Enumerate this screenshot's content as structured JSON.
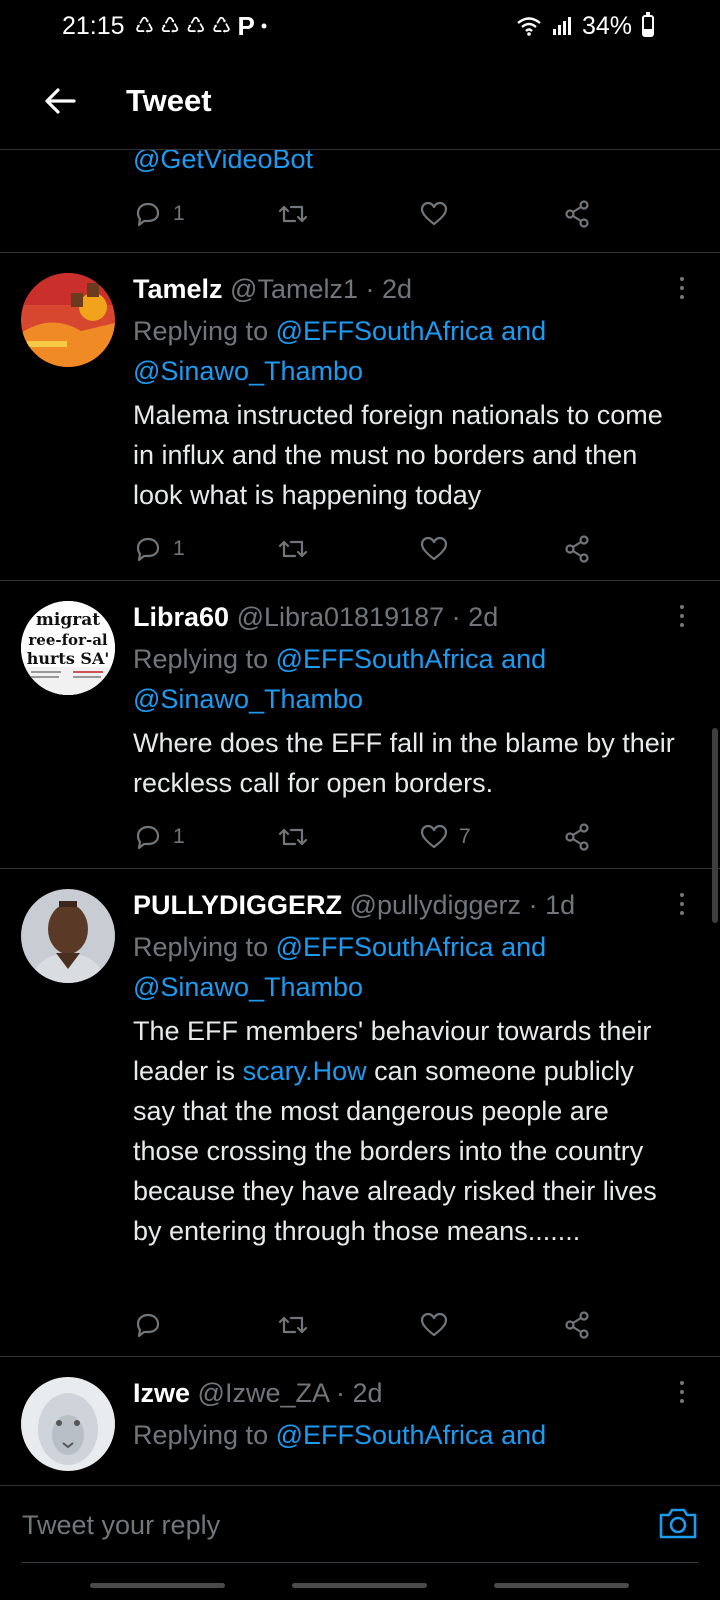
{
  "status": {
    "time": "21:15",
    "battery": "34%",
    "battery_level": 0.34,
    "notif_icons": [
      "recycle-icon",
      "recycle-icon",
      "recycle-icon",
      "recycle-icon",
      "p-icon"
    ]
  },
  "header": {
    "title": "Tweet",
    "back_icon": "arrow-left-icon"
  },
  "previous": {
    "link": "@GetVideoBot",
    "reply_count": "1"
  },
  "tweets": [
    {
      "name": "Tamelz",
      "handle": "@Tamelz1",
      "time": "2d",
      "replying_prefix": "Replying to ",
      "mention1": "@EFFSouthAfrica and",
      "mention2": "@Sinawo_Thambo",
      "text": "Malema instructed foreign nationals to come in influx and the must no borders and then look what is happening today",
      "reply_count": "1",
      "like_count": ""
    },
    {
      "name": "Libra60",
      "handle": "@Libra01819187",
      "time": "2d",
      "replying_prefix": "Replying to ",
      "mention1": "@EFFSouthAfrica and",
      "mention2": "@Sinawo_Thambo",
      "text": "Where does the EFF fall in the blame by their reckless call for open borders.",
      "reply_count": "1",
      "like_count": "7",
      "avatar_text": [
        "migrat",
        "ree-for-al",
        "hurts SA'"
      ]
    },
    {
      "name": "PULLYDIGGERZ",
      "handle": "@pullydiggerz",
      "time": "1d",
      "replying_prefix": "Replying to ",
      "mention1": "@EFFSouthAfrica and",
      "mention2": "@Sinawo_Thambo",
      "text_before": "The EFF members' behaviour towards their leader is ",
      "text_link": "scary.How",
      "text_after": " can someone publicly say that the most dangerous people are those crossing the borders into the country because they have already risked their lives by entering through those means.......",
      "reply_count": "",
      "like_count": ""
    },
    {
      "name": "Izwe",
      "handle": "@Izwe_ZA",
      "time": "2d",
      "replying_prefix": "Replying to ",
      "mention1": "@EFFSouthAfrica and"
    }
  ],
  "compose": {
    "placeholder": "Tweet your reply",
    "camera_icon": "camera-icon"
  },
  "colors": {
    "accent": "#1d9bf0",
    "muted": "#71767b",
    "background": "#000000",
    "divider": "#2f3336"
  }
}
